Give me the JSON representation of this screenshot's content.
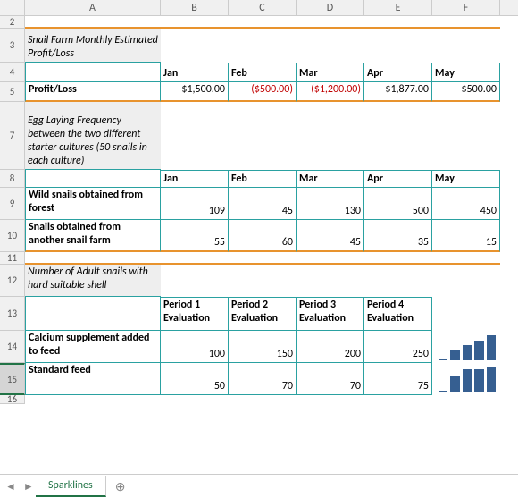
{
  "cols": [
    "A",
    "B",
    "C",
    "D",
    "E",
    "F"
  ],
  "rows_labels": [
    "2",
    "3",
    "4",
    "5",
    "7",
    "8",
    "9",
    "10",
    "11",
    "12",
    "13",
    "14",
    "15",
    "16"
  ],
  "section1": {
    "title": "Snail Farm Monthly Estimated Profit/Loss",
    "months": [
      "Jan",
      "Feb",
      "Mar",
      "Apr",
      "May"
    ],
    "row_label": "Profit/Loss",
    "values": [
      "$1,500.00",
      "($500.00)",
      "($1,200.00)",
      "$1,877.00",
      "$500.00"
    ]
  },
  "section2": {
    "title": "Egg Laying Frequency between the two different starter cultures (50 snails in each culture)",
    "months": [
      "Jan",
      "Feb",
      "Mar",
      "Apr",
      "May"
    ],
    "row1_label": "Wild snails obtained from forest",
    "row1_values": [
      "109",
      "45",
      "130",
      "500",
      "450"
    ],
    "row2_label": "Snails obtained from another snail farm",
    "row2_values": [
      "55",
      "60",
      "45",
      "35",
      "15"
    ]
  },
  "section3": {
    "title": "Number of Adult snails with hard suitable shell",
    "periods": [
      "Period 1 Evaluation",
      "Period 2 Evaluation",
      "Period 3 Evaluation",
      "Period 4 Evaluation"
    ],
    "row1_label": "Calcium supplement added to feed",
    "row1_values": [
      "100",
      "150",
      "200",
      "250"
    ],
    "row2_label": "Standard feed",
    "row2_values": [
      "50",
      "70",
      "70",
      "75"
    ]
  },
  "tab": {
    "name": "Sparklines"
  },
  "chart_data": [
    {
      "type": "bar",
      "series_name": "Calcium supplement added to feed",
      "categories": [
        "Period 1",
        "Period 2",
        "Period 3",
        "Period 4"
      ],
      "values": [
        100,
        150,
        200,
        250
      ]
    },
    {
      "type": "bar",
      "series_name": "Standard feed",
      "categories": [
        "Period 1",
        "Period 2",
        "Period 3",
        "Period 4"
      ],
      "values": [
        50,
        70,
        70,
        75
      ]
    }
  ]
}
